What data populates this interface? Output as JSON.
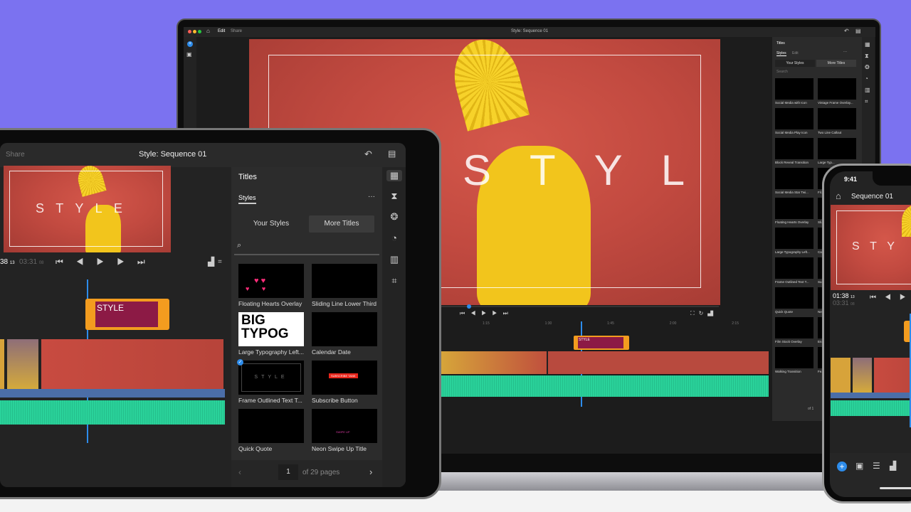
{
  "colors": {
    "background": "#7b72f0",
    "accent": "#2d8ceb",
    "title_clip": "#f39c1f",
    "title_clip_fill": "#8c1a45",
    "audio": "#2ad29a"
  },
  "laptop": {
    "tabs": [
      "Edit",
      "Share"
    ],
    "title": "Style: Sequence 01",
    "preview_text": "STYLE",
    "panel": {
      "title": "Titles",
      "tabs": [
        "Styles",
        "Edit"
      ],
      "more": "···",
      "buttons": [
        "Your Styles",
        "More Titles"
      ],
      "search_placeholder": "Search",
      "items": [
        "Social Media with Icon",
        "Vintage Frame Overlay...",
        "Social Media Play Icon",
        "Two Line Callout",
        "Block Reveal Transition",
        "Large Typ...",
        "Social Media Star Twi...",
        "Fil...",
        "Floating Hearts Overlay",
        "Sli...",
        "Large Typography Left...",
        "Ca...",
        "Frame Outlined Text T...",
        "Su...",
        "Quick Quote",
        "Ne...",
        "Film Stock Overlay",
        "En...",
        "Walking Transition",
        "Fe..."
      ],
      "page_of": "of 1"
    },
    "ruler": [
      "1:15",
      "1:30",
      "1:45",
      "2:00",
      "2:15"
    ],
    "clip_label": "STYLE"
  },
  "tablet": {
    "share": "Share",
    "title": "Style: Sequence 01",
    "preview_text": "STYLE",
    "time_current": "38",
    "time_current_frames": "13",
    "time_total": "03:31",
    "time_total_frames": "08",
    "clip_label": "STYLE",
    "panel": {
      "title": "Titles",
      "tab": "Styles",
      "more": "···",
      "your_styles": "Your Styles",
      "more_titles": "More Titles",
      "items": [
        {
          "label": "Floating Hearts Overlay"
        },
        {
          "label": "Sliding Line Lower Third"
        },
        {
          "label": "Large Typography Left...",
          "thumb_text": "BIG TYPOG"
        },
        {
          "label": "Calendar Date"
        },
        {
          "label": "Frame Outlined Text T...",
          "thumb_text": "STYLE"
        },
        {
          "label": "Subscribe Button",
          "thumb_text": "SUBSCRIBE TANK"
        },
        {
          "label": "Quick Quote"
        },
        {
          "label": "Neon Swipe Up Title",
          "thumb_text": "SWIPE UP"
        }
      ],
      "page": "1",
      "page_of": "of 29 pages"
    }
  },
  "phone": {
    "clock": "9:41",
    "title": "Sequence 01",
    "preview_text": "STY",
    "time_current": "01:38",
    "time_current_frames": "13",
    "time_total": "03:31",
    "time_total_frames": "08"
  }
}
